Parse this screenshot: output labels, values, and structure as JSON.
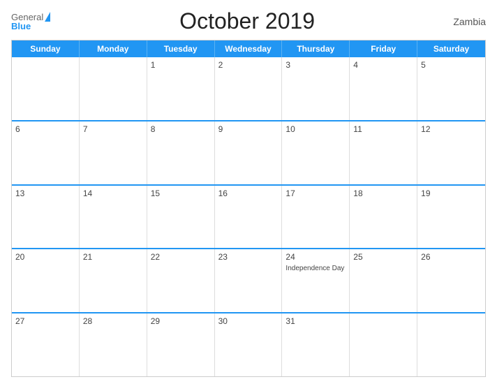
{
  "header": {
    "title": "October 2019",
    "country": "Zambia",
    "logo_general": "General",
    "logo_blue": "Blue"
  },
  "calendar": {
    "days_of_week": [
      "Sunday",
      "Monday",
      "Tuesday",
      "Wednesday",
      "Thursday",
      "Friday",
      "Saturday"
    ],
    "weeks": [
      [
        {
          "day": "",
          "empty": true
        },
        {
          "day": "",
          "empty": true
        },
        {
          "day": "1",
          "empty": false,
          "event": ""
        },
        {
          "day": "2",
          "empty": false,
          "event": ""
        },
        {
          "day": "3",
          "empty": false,
          "event": ""
        },
        {
          "day": "4",
          "empty": false,
          "event": ""
        },
        {
          "day": "5",
          "empty": false,
          "event": ""
        }
      ],
      [
        {
          "day": "6",
          "empty": false,
          "event": ""
        },
        {
          "day": "7",
          "empty": false,
          "event": ""
        },
        {
          "day": "8",
          "empty": false,
          "event": ""
        },
        {
          "day": "9",
          "empty": false,
          "event": ""
        },
        {
          "day": "10",
          "empty": false,
          "event": ""
        },
        {
          "day": "11",
          "empty": false,
          "event": ""
        },
        {
          "day": "12",
          "empty": false,
          "event": ""
        }
      ],
      [
        {
          "day": "13",
          "empty": false,
          "event": ""
        },
        {
          "day": "14",
          "empty": false,
          "event": ""
        },
        {
          "day": "15",
          "empty": false,
          "event": ""
        },
        {
          "day": "16",
          "empty": false,
          "event": ""
        },
        {
          "day": "17",
          "empty": false,
          "event": ""
        },
        {
          "day": "18",
          "empty": false,
          "event": ""
        },
        {
          "day": "19",
          "empty": false,
          "event": ""
        }
      ],
      [
        {
          "day": "20",
          "empty": false,
          "event": ""
        },
        {
          "day": "21",
          "empty": false,
          "event": ""
        },
        {
          "day": "22",
          "empty": false,
          "event": ""
        },
        {
          "day": "23",
          "empty": false,
          "event": ""
        },
        {
          "day": "24",
          "empty": false,
          "event": "Independence Day"
        },
        {
          "day": "25",
          "empty": false,
          "event": ""
        },
        {
          "day": "26",
          "empty": false,
          "event": ""
        }
      ],
      [
        {
          "day": "27",
          "empty": false,
          "event": ""
        },
        {
          "day": "28",
          "empty": false,
          "event": ""
        },
        {
          "day": "29",
          "empty": false,
          "event": ""
        },
        {
          "day": "30",
          "empty": false,
          "event": ""
        },
        {
          "day": "31",
          "empty": false,
          "event": ""
        },
        {
          "day": "",
          "empty": true
        },
        {
          "day": "",
          "empty": true
        }
      ]
    ]
  }
}
